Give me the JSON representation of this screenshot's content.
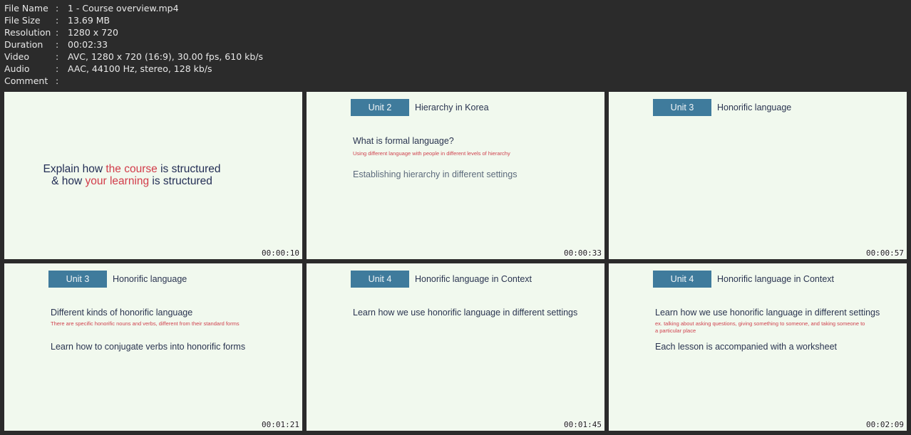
{
  "file_info": [
    {
      "key": "File Name",
      "value": "1 - Course overview.mp4"
    },
    {
      "key": "File Size",
      "value": "13.69 MB"
    },
    {
      "key": "Resolution",
      "value": "1280 x 720"
    },
    {
      "key": "Duration",
      "value": "00:02:33"
    },
    {
      "key": "Video",
      "value": "AVC, 1280 x 720 (16:9), 30.00 fps, 610 kb/s"
    },
    {
      "key": "Audio",
      "value": "AAC, 44100 Hz, stereo, 128 kb/s"
    },
    {
      "key": "Comment",
      "value": ""
    }
  ],
  "separator": ":",
  "thumbs": [
    {
      "timestamp": "00:00:10",
      "intro": {
        "line1_a": "Explain how ",
        "line1_hl": "the course",
        "line1_b": " is structured",
        "line2_a": "& how ",
        "line2_hl": "your learning",
        "line2_b": " is structured"
      }
    },
    {
      "timestamp": "00:00:33",
      "unit": "Unit 2",
      "title": "Hierarchy in Korea",
      "q1": "What is formal language?",
      "q1_sub": "Using different language with people in different levels of hierarchy",
      "q2": "Establishing hierarchy in different settings"
    },
    {
      "timestamp": "00:00:57",
      "unit": "Unit 3",
      "title": "Honorific language"
    },
    {
      "timestamp": "00:01:21",
      "unit": "Unit 3",
      "title": "Honorific language",
      "q1": "Different kinds of honorific language",
      "q1_sub": "There are specific honorific nouns and verbs, different from their standard forms",
      "q2": "Learn how to conjugate verbs into honorific forms"
    },
    {
      "timestamp": "00:01:45",
      "unit": "Unit 4",
      "title": "Honorific language in Context",
      "q1": "Learn how we use honorific language in different settings"
    },
    {
      "timestamp": "00:02:09",
      "unit": "Unit 4",
      "title": "Honorific language in Context",
      "q1": "Learn how we use honorific language in different settings",
      "q1_sub": "ex. talking about asking questions, giving something to someone, and taking someone to a particular place",
      "q2": "Each lesson is accompanied with a worksheet"
    }
  ]
}
